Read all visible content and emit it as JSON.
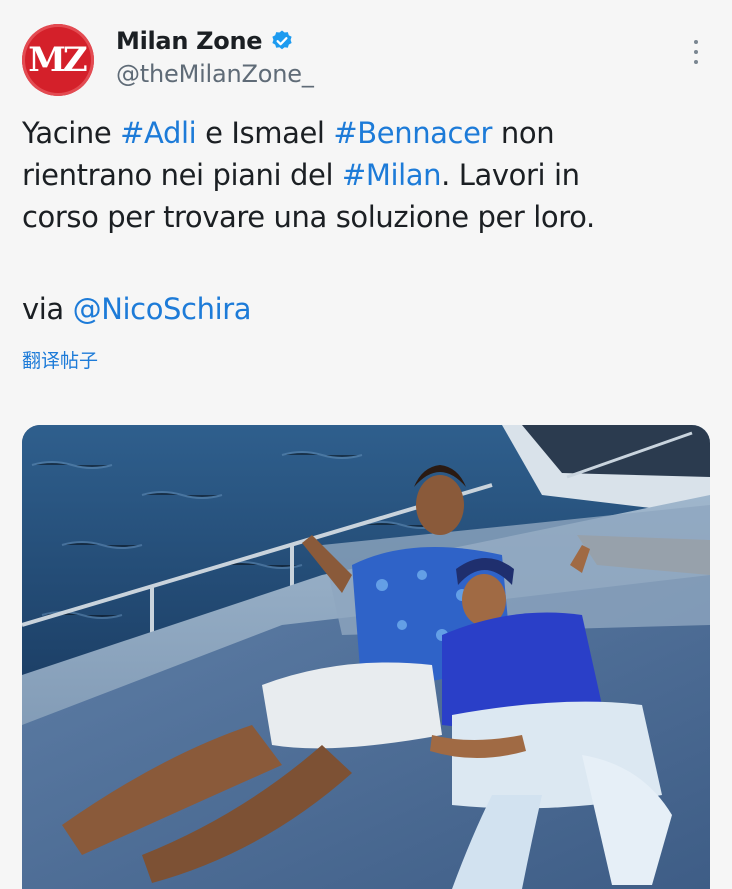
{
  "author": {
    "avatar_text": "MZ",
    "display_name": "Milan Zone",
    "handle": "@theMilanZone_",
    "verified": true
  },
  "tweet": {
    "line1": [
      {
        "text": "Yacine ",
        "link": false
      },
      {
        "text": "#Adli",
        "link": true
      },
      {
        "text": " e Ismael ",
        "link": false
      },
      {
        "text": "#Bennacer",
        "link": true
      },
      {
        "text": " non",
        "link": false
      }
    ],
    "line2": [
      {
        "text": "rientrano nei piani del ",
        "link": false
      },
      {
        "text": "#Milan",
        "link": true
      },
      {
        "text": ". Lavori in",
        "link": false
      }
    ],
    "line3": [
      {
        "text": "corso per trovare una soluzione per loro.",
        "link": false
      }
    ],
    "via_prefix": "via ",
    "via_mention": "@NicoSchira",
    "translate_label": "翻译帖子"
  },
  "media": {
    "description_icon": "photo"
  },
  "colors": {
    "link": "#1d7bd8",
    "avatar": "#d4202a",
    "verified": "#1d9bf0"
  },
  "icons": {
    "verified": "verified-badge-icon",
    "more": "more-vertical-icon"
  }
}
